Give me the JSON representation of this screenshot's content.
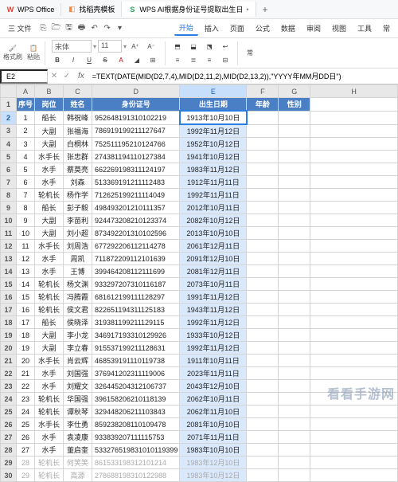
{
  "tabs": [
    {
      "icon": "W",
      "iconColor": "#e03e2d",
      "label": "WPS Office"
    },
    {
      "icon": "◧",
      "iconColor": "#ff8a3d",
      "label": "找稻壳模板"
    },
    {
      "icon": "S",
      "iconColor": "#2e9e5b",
      "label": "WPS AI根据身份证号提取出生日"
    }
  ],
  "menubar": {
    "file": "三 文件",
    "items": [
      "开始",
      "插入",
      "页面",
      "公式",
      "数据",
      "审阅",
      "视图",
      "工具"
    ],
    "active": "开始",
    "more": "常"
  },
  "toolbar": {
    "formatPainter": "格式刷",
    "paste": "粘贴",
    "font": "宋体",
    "size": "11"
  },
  "formulaBar": {
    "cellRef": "E2",
    "formula": "=TEXT(DATE(MID(D2,7,4),MID(D2,11,2),MID(D2,13,2)),\"YYYY年MM月DD日\")"
  },
  "colHeads": [
    "A",
    "B",
    "C",
    "D",
    "E",
    "F",
    "G",
    "H"
  ],
  "headers": [
    "序号",
    "岗位",
    "姓名",
    "身份证号",
    "出生日期",
    "年龄",
    "性别"
  ],
  "rows": [
    {
      "n": "1",
      "pos": "船长",
      "name": "韩祝峰",
      "id": "952648191310102219",
      "dob": "1913年10月10日"
    },
    {
      "n": "2",
      "pos": "大副",
      "name": "张福海",
      "id": "786919199211127647",
      "dob": "1992年11月12日"
    },
    {
      "n": "3",
      "pos": "大副",
      "name": "白桐林",
      "id": "752511195210124766",
      "dob": "1952年10月12日"
    },
    {
      "n": "4",
      "pos": "水手长",
      "name": "张忠群",
      "id": "274381194110127384",
      "dob": "1941年10月12日"
    },
    {
      "n": "5",
      "pos": "水手",
      "name": "蔡莫亮",
      "id": "662269198311124197",
      "dob": "1983年11月12日"
    },
    {
      "n": "6",
      "pos": "水手",
      "name": "刘森",
      "id": "513369191211112483",
      "dob": "1912年11月11日"
    },
    {
      "n": "7",
      "pos": "轮机长",
      "name": "杨作学",
      "id": "712625199211114049",
      "dob": "1992年11月11日"
    },
    {
      "n": "8",
      "pos": "船长",
      "name": "彭子毅",
      "id": "498493201210111357",
      "dob": "2012年10月11日"
    },
    {
      "n": "9",
      "pos": "大副",
      "name": "李苗利",
      "id": "924473208210123374",
      "dob": "2082年10月12日"
    },
    {
      "n": "10",
      "pos": "大副",
      "name": "刘小超",
      "id": "873492201310102596",
      "dob": "2013年10月10日"
    },
    {
      "n": "11",
      "pos": "水手长",
      "name": "刘周浩",
      "id": "677292206112114278",
      "dob": "2061年12月11日"
    },
    {
      "n": "12",
      "pos": "水手",
      "name": "周凯",
      "id": "711872209112101639",
      "dob": "2091年12月10日"
    },
    {
      "n": "13",
      "pos": "水手",
      "name": "王博",
      "id": "399464208112111699",
      "dob": "2081年12月11日"
    },
    {
      "n": "14",
      "pos": "轮机长",
      "name": "杨文渊",
      "id": "933297207310116187",
      "dob": "2073年10月11日"
    },
    {
      "n": "15",
      "pos": "轮机长",
      "name": "冯腾霞",
      "id": "681612199111128297",
      "dob": "1991年11月12日"
    },
    {
      "n": "16",
      "pos": "轮机长",
      "name": "侯文君",
      "id": "822651194311125183",
      "dob": "1943年11月12日"
    },
    {
      "n": "17",
      "pos": "船长",
      "name": "侯晓泽",
      "id": "319381199211129115",
      "dob": "1992年11月12日"
    },
    {
      "n": "18",
      "pos": "大副",
      "name": "李小龙",
      "id": "346917193310129926",
      "dob": "1933年10月12日"
    },
    {
      "n": "19",
      "pos": "大副",
      "name": "李立春",
      "id": "915537199211128631",
      "dob": "1992年11月12日"
    },
    {
      "n": "20",
      "pos": "水手长",
      "name": "肖云辉",
      "id": "468539191110119738",
      "dob": "1911年10月11日"
    },
    {
      "n": "21",
      "pos": "水手",
      "name": "刘国强",
      "id": "376941202311119006",
      "dob": "2023年11月11日"
    },
    {
      "n": "22",
      "pos": "水手",
      "name": "刘耀文",
      "id": "326445204312106737",
      "dob": "2043年12月10日"
    },
    {
      "n": "23",
      "pos": "轮机长",
      "name": "华国强",
      "id": "396158206210118139",
      "dob": "2062年10月11日"
    },
    {
      "n": "24",
      "pos": "轮机长",
      "name": "谭秋琴",
      "id": "329448206211103843",
      "dob": "2062年11月10日"
    },
    {
      "n": "25",
      "pos": "水手长",
      "name": "李仕勇",
      "id": "859238208110109478",
      "dob": "2081年10月10日"
    },
    {
      "n": "26",
      "pos": "水手",
      "name": "袁凌康",
      "id": "933839207111115753",
      "dob": "2071年11月11日"
    },
    {
      "n": "27",
      "pos": "水手",
      "name": "董启奎",
      "id": "533276519831010119399",
      "dob": "1983年10月10日"
    },
    {
      "n": "28",
      "pos": "轮机长",
      "name": "何笑笑",
      "id": "861533198312101214",
      "dob": "1983年12月10日"
    },
    {
      "n": "29",
      "pos": "轮机长",
      "name": "高源",
      "id": "278688198310122988",
      "dob": "1983年10月12日"
    }
  ],
  "watermark": "看看手游网"
}
